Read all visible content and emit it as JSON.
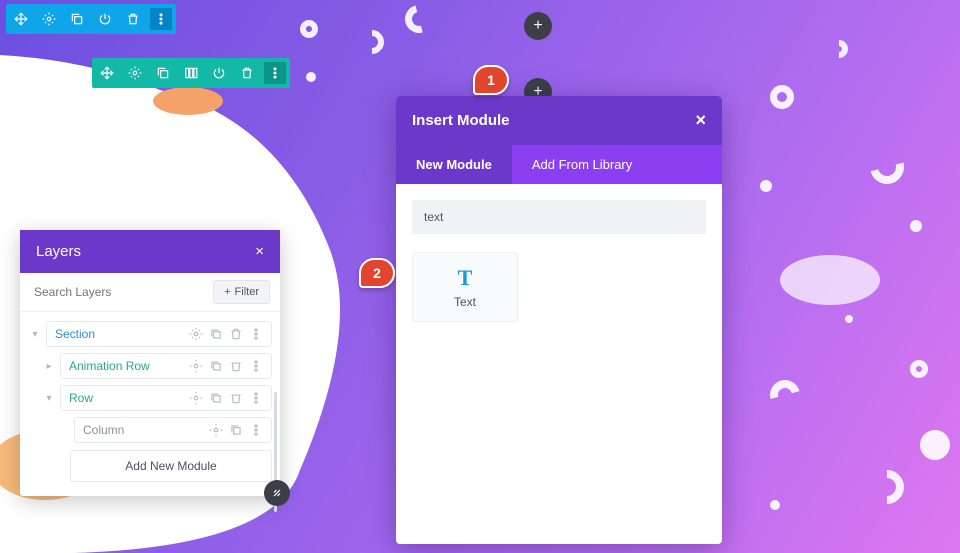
{
  "toolbars": {
    "blue_icons": [
      "move",
      "gear",
      "duplicate",
      "power",
      "trash",
      "more"
    ],
    "teal_icons": [
      "move",
      "gear",
      "duplicate",
      "columns",
      "power",
      "trash",
      "more"
    ]
  },
  "modal": {
    "title": "Insert Module",
    "close": "×",
    "tabs": {
      "new": "New Module",
      "library": "Add From Library"
    },
    "search_value": "text",
    "module": {
      "icon_glyph": "T",
      "label": "Text"
    }
  },
  "layers": {
    "title": "Layers",
    "close": "×",
    "search_placeholder": "Search Layers",
    "filter_label": "Filter",
    "tree": {
      "section": "Section",
      "anim_row": "Animation Row",
      "row": "Row",
      "column": "Column",
      "add_new": "Add New Module"
    }
  },
  "callouts": {
    "one": "1",
    "two": "2"
  }
}
